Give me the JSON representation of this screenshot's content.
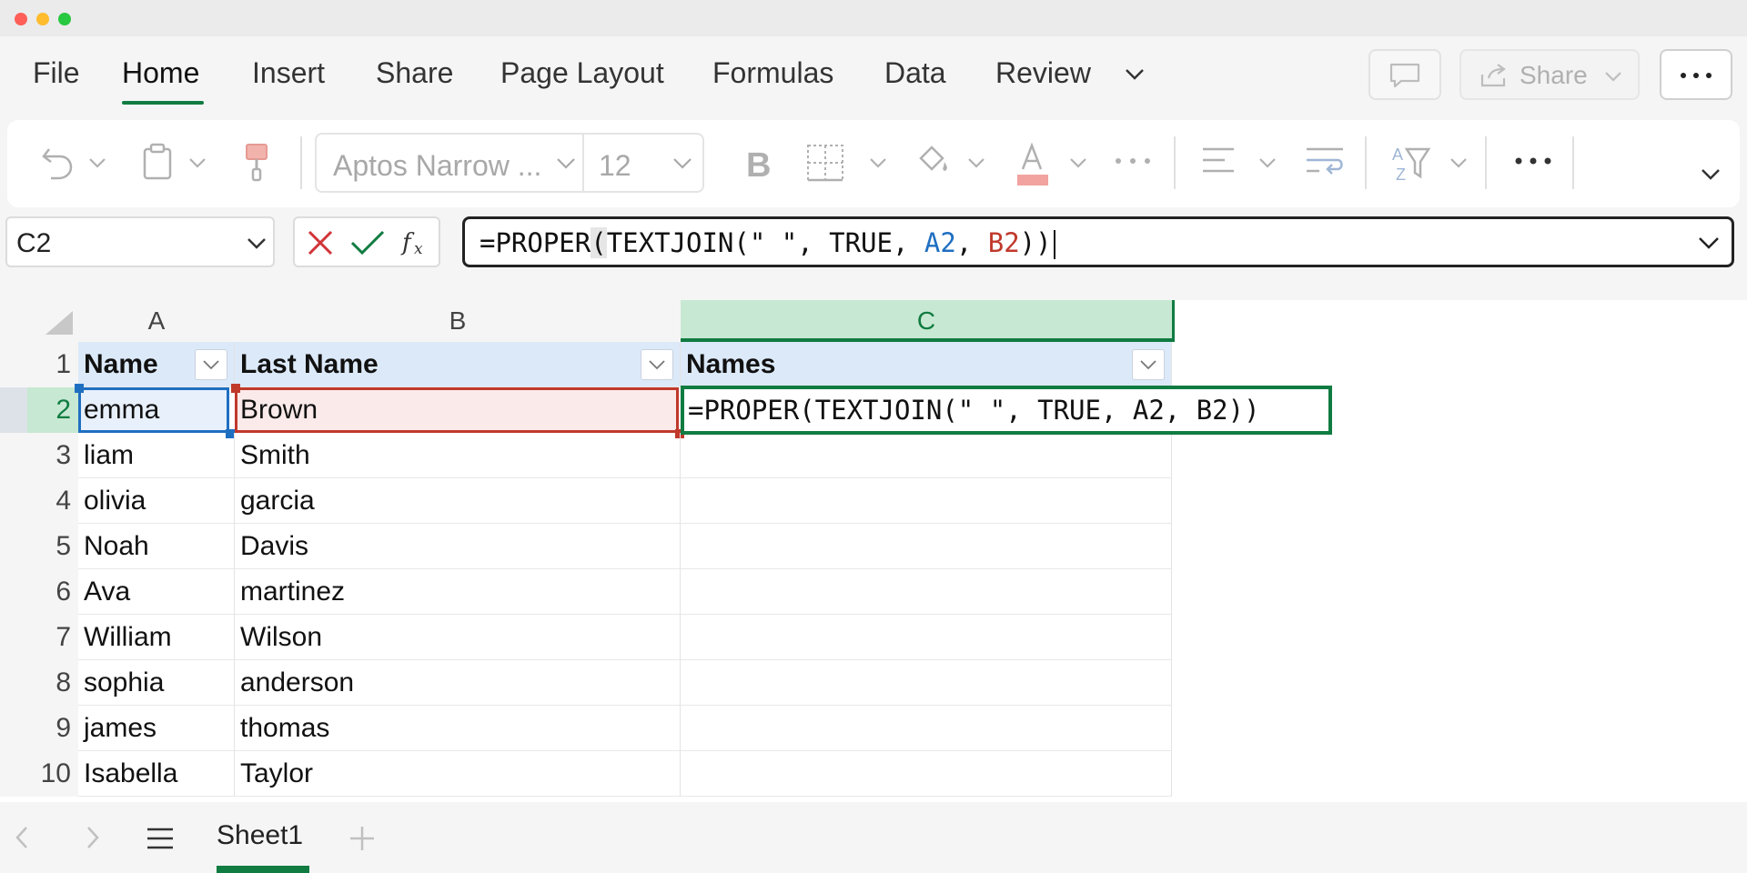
{
  "menu": {
    "tabs": [
      "File",
      "Home",
      "Insert",
      "Share",
      "Page Layout",
      "Formulas",
      "Data",
      "Review"
    ],
    "active_tab": "Home",
    "share_label": "Share"
  },
  "ribbon": {
    "font_name": "Aptos Narrow ...",
    "font_size": "12"
  },
  "formula_bar": {
    "name_box": "C2",
    "formula_prefix": "=PROPER",
    "formula_paren": "(",
    "formula_mid": "TEXTJOIN(\" \", TRUE, ",
    "ref_a": "A2",
    "comma": ", ",
    "ref_b": "B2",
    "formula_end": "))"
  },
  "grid": {
    "columns": [
      "A",
      "B",
      "C"
    ],
    "selected_column": "C",
    "row_numbers": [
      "1",
      "2",
      "3",
      "4",
      "5",
      "6",
      "7",
      "8",
      "9",
      "10"
    ],
    "headers": [
      "Name",
      "Last Name",
      "Names"
    ],
    "rows": [
      [
        "emma",
        "Brown"
      ],
      [
        "liam",
        "Smith"
      ],
      [
        "olivia",
        "garcia"
      ],
      [
        "Noah",
        "Davis"
      ],
      [
        "Ava",
        "martinez"
      ],
      [
        "William",
        "Wilson"
      ],
      [
        "sophia",
        "anderson"
      ],
      [
        "james",
        "thomas"
      ],
      [
        "Isabella",
        "Taylor"
      ]
    ],
    "active_cell_formula": "=PROPER(TEXTJOIN(\" \", TRUE, A2, B2))"
  },
  "sheets": {
    "tabs": [
      "Sheet1"
    ],
    "active": "Sheet1"
  },
  "colors": {
    "accent": "#107c41",
    "ref_a": "#1f6fc1",
    "ref_b": "#c0392b",
    "header_fill": "#dce9f9"
  }
}
